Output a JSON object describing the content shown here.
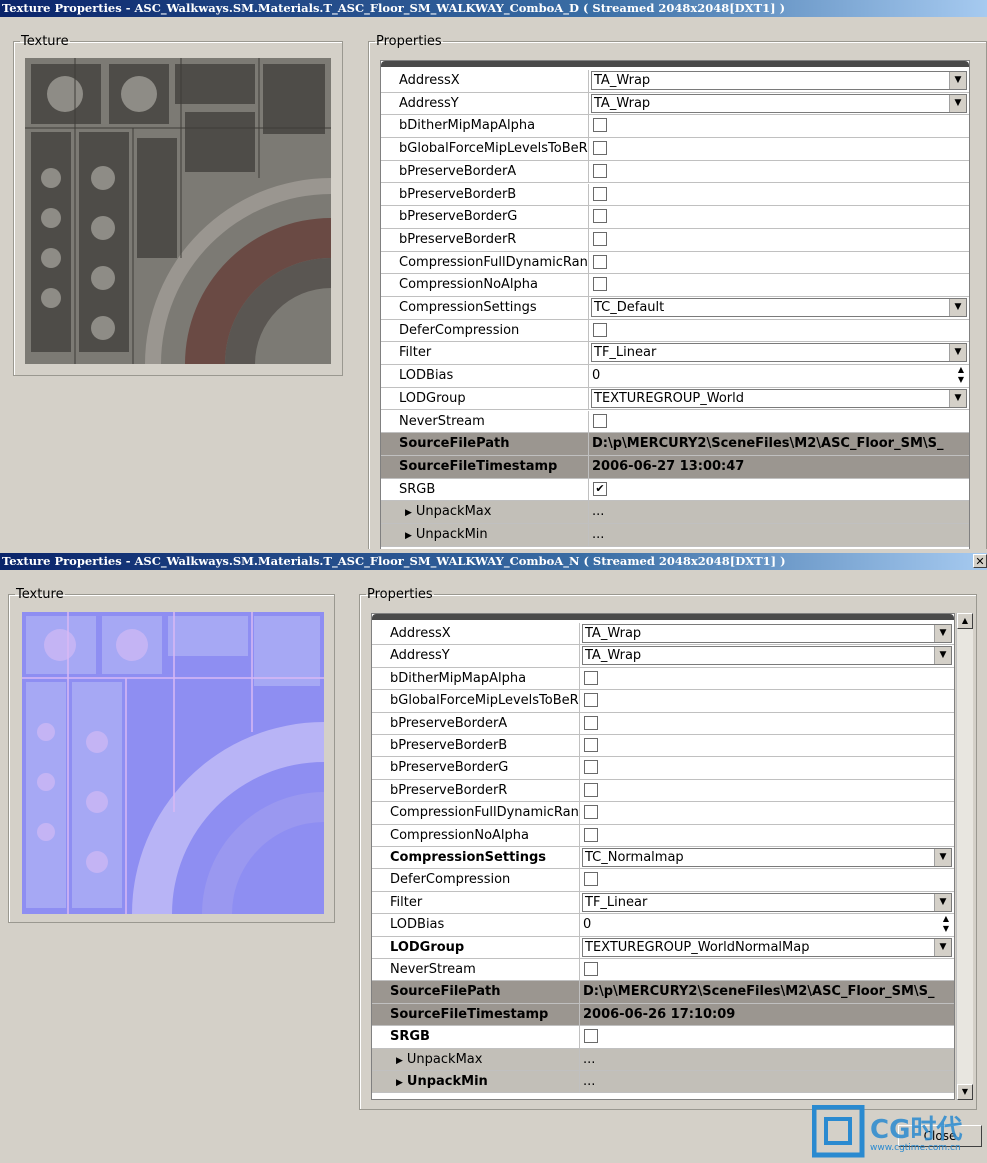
{
  "windows": [
    {
      "title": "Texture Properties - ASC_Walkways.SM.Materials.T_ASC_Floor_SM_WALKWAY_ComboA_D ( Streamed 2048x2048[DXT1] )",
      "texture_label": "Texture",
      "properties_label": "Properties",
      "rows": [
        {
          "name": "AddressX",
          "type": "combo",
          "value": "TA_Wrap"
        },
        {
          "name": "AddressY",
          "type": "combo",
          "value": "TA_Wrap"
        },
        {
          "name": "bDitherMipMapAlpha",
          "type": "check",
          "checked": false
        },
        {
          "name": "bGlobalForceMipLevelsToBeR",
          "type": "check",
          "checked": false
        },
        {
          "name": "bPreserveBorderA",
          "type": "check",
          "checked": false
        },
        {
          "name": "bPreserveBorderB",
          "type": "check",
          "checked": false
        },
        {
          "name": "bPreserveBorderG",
          "type": "check",
          "checked": false
        },
        {
          "name": "bPreserveBorderR",
          "type": "check",
          "checked": false
        },
        {
          "name": "CompressionFullDynamicRang",
          "type": "check",
          "checked": false
        },
        {
          "name": "CompressionNoAlpha",
          "type": "check",
          "checked": false
        },
        {
          "name": "CompressionSettings",
          "type": "combo",
          "value": "TC_Default"
        },
        {
          "name": "DeferCompression",
          "type": "check",
          "checked": false
        },
        {
          "name": "Filter",
          "type": "combo",
          "value": "TF_Linear"
        },
        {
          "name": "LODBias",
          "type": "spin",
          "value": "0"
        },
        {
          "name": "LODGroup",
          "type": "combo",
          "value": "TEXTUREGROUP_World"
        },
        {
          "name": "NeverStream",
          "type": "check",
          "checked": false
        },
        {
          "name": "SourceFilePath",
          "type": "dark",
          "value": "D:\\p\\MERCURY2\\SceneFiles\\M2\\ASC_Floor_SM\\S_"
        },
        {
          "name": "SourceFileTimestamp",
          "type": "dark",
          "value": "2006-06-27 13:00:47"
        },
        {
          "name": "SRGB",
          "type": "check",
          "checked": true
        },
        {
          "name": "UnpackMax",
          "type": "sub",
          "value": "..."
        },
        {
          "name": "UnpackMin",
          "type": "sub",
          "value": "..."
        }
      ]
    },
    {
      "title": "Texture Properties - ASC_Walkways.SM.Materials.T_ASC_Floor_SM_WALKWAY_ComboA_N ( Streamed 2048x2048[DXT1] )",
      "texture_label": "Texture",
      "properties_label": "Properties",
      "rows": [
        {
          "name": "AddressX",
          "type": "combo",
          "value": "TA_Wrap"
        },
        {
          "name": "AddressY",
          "type": "combo",
          "value": "TA_Wrap"
        },
        {
          "name": "bDitherMipMapAlpha",
          "type": "check",
          "checked": false
        },
        {
          "name": "bGlobalForceMipLevelsToBeR",
          "type": "check",
          "checked": false
        },
        {
          "name": "bPreserveBorderA",
          "type": "check",
          "checked": false
        },
        {
          "name": "bPreserveBorderB",
          "type": "check",
          "checked": false
        },
        {
          "name": "bPreserveBorderG",
          "type": "check",
          "checked": false
        },
        {
          "name": "bPreserveBorderR",
          "type": "check",
          "checked": false
        },
        {
          "name": "CompressionFullDynamicRang",
          "type": "check",
          "checked": false
        },
        {
          "name": "CompressionNoAlpha",
          "type": "check",
          "checked": false
        },
        {
          "name": "CompressionSettings",
          "type": "combo",
          "value": "TC_Normalmap",
          "bold": true
        },
        {
          "name": "DeferCompression",
          "type": "check",
          "checked": false
        },
        {
          "name": "Filter",
          "type": "combo",
          "value": "TF_Linear"
        },
        {
          "name": "LODBias",
          "type": "spin",
          "value": "0"
        },
        {
          "name": "LODGroup",
          "type": "combo",
          "value": "TEXTUREGROUP_WorldNormalMap",
          "bold": true
        },
        {
          "name": "NeverStream",
          "type": "check",
          "checked": false
        },
        {
          "name": "SourceFilePath",
          "type": "dark",
          "value": "D:\\p\\MERCURY2\\SceneFiles\\M2\\ASC_Floor_SM\\S_"
        },
        {
          "name": "SourceFileTimestamp",
          "type": "dark",
          "value": "2006-06-26 17:10:09"
        },
        {
          "name": "SRGB",
          "type": "check",
          "checked": false,
          "bold": true
        },
        {
          "name": "UnpackMax",
          "type": "sub",
          "value": "..."
        },
        {
          "name": "UnpackMin",
          "type": "sub",
          "value": "...",
          "bold": true
        }
      ],
      "close_label": "Close"
    }
  ],
  "watermark": {
    "brand": "CG时代",
    "url": "www.cgtime.com.cn"
  }
}
